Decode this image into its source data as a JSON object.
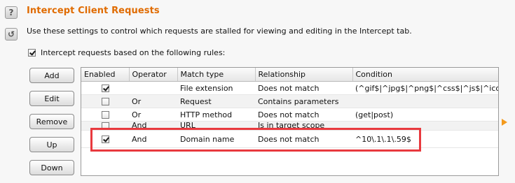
{
  "header": {
    "title": "Intercept Client Requests",
    "description": "Use these settings to control which requests are stalled for viewing and editing in the Intercept tab."
  },
  "icons": {
    "help": "?",
    "refresh": "↺"
  },
  "enable_rules": {
    "label": "Intercept requests based on the following rules:",
    "checked": true
  },
  "buttons": {
    "add": "Add",
    "edit": "Edit",
    "remove": "Remove",
    "up": "Up",
    "down": "Down"
  },
  "table": {
    "columns": [
      "Enabled",
      "Operator",
      "Match type",
      "Relationship",
      "Condition"
    ],
    "rows": [
      {
        "enabled": true,
        "operator": "",
        "match_type": "File extension",
        "relationship": "Does not match",
        "condition": "(^gif$|^jpg$|^png$|^css$|^js$|^ico$)"
      },
      {
        "enabled": false,
        "operator": "Or",
        "match_type": "Request",
        "relationship": "Contains parameters",
        "condition": ""
      },
      {
        "enabled": false,
        "operator": "Or",
        "match_type": "HTTP method",
        "relationship": "Does not match",
        "condition": "(get|post)"
      },
      {
        "enabled": false,
        "operator": "And",
        "match_type": "URL",
        "relationship": "Is in target scope",
        "condition": ""
      },
      {
        "enabled": true,
        "operator": "And",
        "match_type": "Domain name",
        "relationship": "Does not match",
        "condition": "^10\\.1\\.1\\.59$"
      }
    ]
  },
  "colors": {
    "title": "#e06b00",
    "highlight_border": "#e8393e",
    "arrow": "#f39a1d"
  }
}
